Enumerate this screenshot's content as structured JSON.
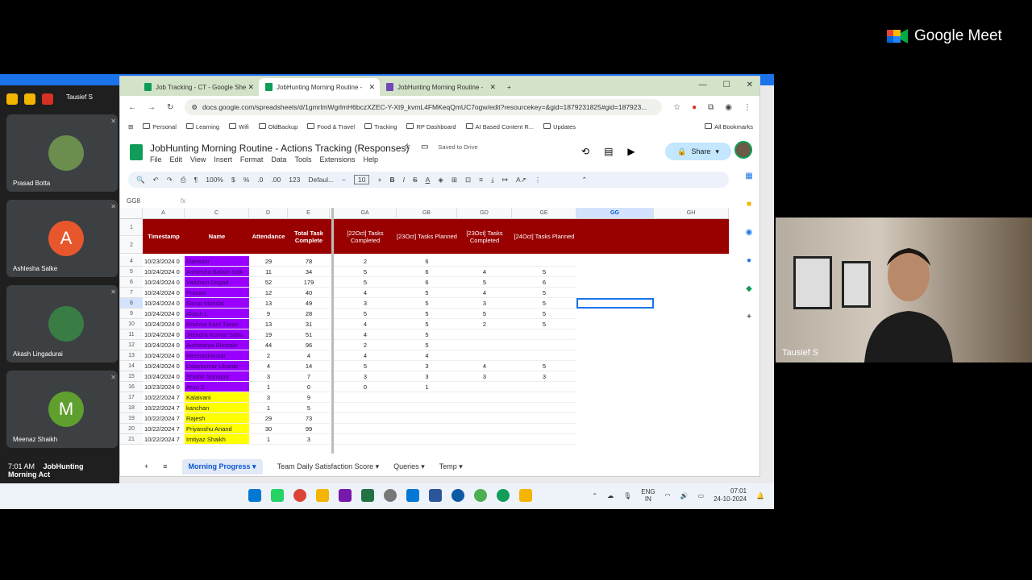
{
  "meet": {
    "brand": "Google Meet",
    "time": "7:01 AM",
    "meeting_name": "JobHunting Morning Act",
    "presenter_label": "Tausief S",
    "sharing_label": "Tausief S"
  },
  "participants": [
    {
      "name": "Prasad Botta",
      "initial": "",
      "color": "#6b8e4e"
    },
    {
      "name": "Ashlesha Salke",
      "initial": "A",
      "color": "#e8572c"
    },
    {
      "name": "Akash Lingadurai",
      "initial": "",
      "color": "#3a7d44"
    },
    {
      "name": "Meenaz Shaikh",
      "initial": "M",
      "color": "#5f9f2e"
    }
  ],
  "browser": {
    "tabs": [
      {
        "label": "Job Tracking - CT - Google She"
      },
      {
        "label": "JobHunting Morning Routine -"
      },
      {
        "label": "JobHunting Morning Routine -"
      }
    ],
    "url": "docs.google.com/spreadsheets/d/1gmrlmWgrlmH6bczXZEC-Y-Xt9_kvmL4FMKeqQmUC7ogw/edit?resourcekey=&gid=1879231825#gid=187923...",
    "bookmarks": [
      "Personal",
      "Learning",
      "Wifi",
      "OldBackup",
      "Food & Travel",
      "Tracking",
      "RP Dashboard",
      "AI Based Content R...",
      "Updates"
    ],
    "all_bookmarks": "All Bookmarks"
  },
  "sheet": {
    "title": "JobHunting Morning Routine - Actions Tracking (Responses)",
    "saved": "Saved to Drive",
    "menu": [
      "File",
      "Edit",
      "View",
      "Insert",
      "Format",
      "Data",
      "Tools",
      "Extensions",
      "Help"
    ],
    "share": "Share",
    "zoom": "100%",
    "currency": "$",
    "percent": "%",
    "decimals_dec": ".0",
    "decimals_inc": ".00",
    "numfmt": "123",
    "font": "Defaul...",
    "font_size": "10",
    "cell_ref": "GG8",
    "fx": "fx",
    "col_letters": [
      "A",
      "C",
      "D",
      "E",
      "GA",
      "GB",
      "GD",
      "GE",
      "GG",
      "GH"
    ],
    "headers": [
      "Timestamp",
      "Name",
      "Attendance",
      "Total Task Complete",
      "[22Oct] Tasks Completed",
      "[23Oct] Tasks Planned",
      "[23Oct] Tasks Completed",
      "[24Oct] Tasks Planned"
    ],
    "header_rows": [
      "1",
      "2"
    ],
    "rows": [
      {
        "n": "4",
        "ts": "10/23/2024 0",
        "name": "Mansoor",
        "att": "29",
        "tot": "78",
        "ga": "2",
        "gb": "6",
        "gd": "",
        "ge": ""
      },
      {
        "n": "5",
        "ts": "10/24/2024 0",
        "name": "Ashlesha Balain Salk",
        "att": "11",
        "tot": "34",
        "ga": "5",
        "gb": "6",
        "gd": "4",
        "ge": "5"
      },
      {
        "n": "6",
        "ts": "10/24/2024 0",
        "name": "Vaibhavi Dogad",
        "att": "52",
        "tot": "179",
        "ga": "5",
        "gb": "6",
        "gd": "5",
        "ge": "6"
      },
      {
        "n": "7",
        "ts": "10/24/2024 0",
        "name": "Prasad",
        "att": "12",
        "tot": "40",
        "ga": "4",
        "gb": "5",
        "gd": "4",
        "ge": "5"
      },
      {
        "n": "8",
        "ts": "10/24/2024 0",
        "name": "Sarup Mondal",
        "att": "13",
        "tot": "49",
        "ga": "3",
        "gb": "5",
        "gd": "3",
        "ge": "5"
      },
      {
        "n": "9",
        "ts": "10/24/2024 0",
        "name": "Akash L",
        "att": "9",
        "tot": "28",
        "ga": "5",
        "gb": "5",
        "gd": "5",
        "ge": "5"
      },
      {
        "n": "10",
        "ts": "10/24/2024 0",
        "name": "Krishna Kant Tiwari",
        "att": "13",
        "tot": "31",
        "ga": "4",
        "gb": "5",
        "gd": "2",
        "ge": "5"
      },
      {
        "n": "11",
        "ts": "10/24/2024 0",
        "name": "Jitendra Kumar Sahu",
        "att": "19",
        "tot": "51",
        "ga": "4",
        "gb": "5",
        "gd": "",
        "ge": ""
      },
      {
        "n": "12",
        "ts": "10/24/2024 0",
        "name": "Aishwarya Bhosale",
        "att": "44",
        "tot": "96",
        "ga": "2",
        "gb": "5",
        "gd": "",
        "ge": ""
      },
      {
        "n": "13",
        "ts": "10/24/2024 0",
        "name": "Meenazkousar",
        "att": "2",
        "tot": "4",
        "ga": "4",
        "gb": "4",
        "gd": "",
        "ge": ""
      },
      {
        "n": "14",
        "ts": "10/24/2024 0",
        "name": "Udaykumar Ukarde",
        "att": "4",
        "tot": "14",
        "ga": "5",
        "gb": "3",
        "gd": "4",
        "ge": "5"
      },
      {
        "n": "15",
        "ts": "10/24/2024 0",
        "name": "Shishir Sonapur",
        "att": "3",
        "tot": "7",
        "ga": "3",
        "gb": "3",
        "gd": "3",
        "ge": "3"
      },
      {
        "n": "16",
        "ts": "10/23/2024 0",
        "name": "Arun S",
        "att": "1",
        "tot": "0",
        "ga": "0",
        "gb": "1",
        "gd": "",
        "ge": ""
      },
      {
        "n": "17",
        "ts": "10/22/2024 7",
        "name": "Kalaivani",
        "att": "3",
        "tot": "9",
        "ga": "",
        "gb": "",
        "gd": "",
        "ge": ""
      },
      {
        "n": "18",
        "ts": "10/22/2024 7",
        "name": "kanchan",
        "att": "1",
        "tot": "5",
        "ga": "",
        "gb": "",
        "gd": "",
        "ge": ""
      },
      {
        "n": "19",
        "ts": "10/22/2024 7",
        "name": "Rajesh",
        "att": "29",
        "tot": "73",
        "ga": "",
        "gb": "",
        "gd": "",
        "ge": ""
      },
      {
        "n": "20",
        "ts": "10/22/2024 7",
        "name": "Priyanshu Anand",
        "att": "30",
        "tot": "99",
        "ga": "",
        "gb": "",
        "gd": "",
        "ge": ""
      },
      {
        "n": "21",
        "ts": "10/22/2024 7",
        "name": "Imtiyaz Shaikh",
        "att": "1",
        "tot": "3",
        "ga": "",
        "gb": "",
        "gd": "",
        "ge": ""
      }
    ],
    "purple_until": "16",
    "sheet_tabs": [
      "Morning Progress",
      "Team Daily Satisfaction Score",
      "Queries",
      "Temp"
    ]
  },
  "taskbar": {
    "lang": "ENG",
    "region": "IN",
    "time": "07:01",
    "date": "24-10-2024"
  }
}
